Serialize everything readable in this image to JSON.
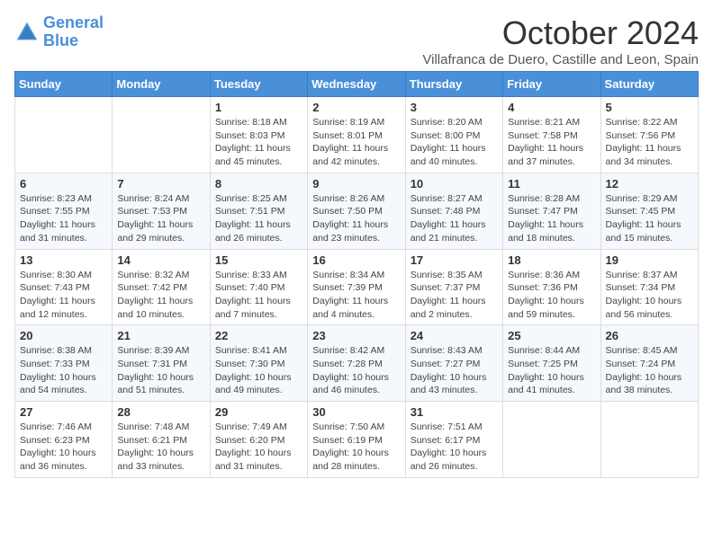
{
  "header": {
    "logo_line1": "General",
    "logo_line2": "Blue",
    "month_year": "October 2024",
    "location": "Villafranca de Duero, Castille and Leon, Spain"
  },
  "weekdays": [
    "Sunday",
    "Monday",
    "Tuesday",
    "Wednesday",
    "Thursday",
    "Friday",
    "Saturday"
  ],
  "weeks": [
    [
      {
        "day": "",
        "info": ""
      },
      {
        "day": "",
        "info": ""
      },
      {
        "day": "1",
        "info": "Sunrise: 8:18 AM\nSunset: 8:03 PM\nDaylight: 11 hours and 45 minutes."
      },
      {
        "day": "2",
        "info": "Sunrise: 8:19 AM\nSunset: 8:01 PM\nDaylight: 11 hours and 42 minutes."
      },
      {
        "day": "3",
        "info": "Sunrise: 8:20 AM\nSunset: 8:00 PM\nDaylight: 11 hours and 40 minutes."
      },
      {
        "day": "4",
        "info": "Sunrise: 8:21 AM\nSunset: 7:58 PM\nDaylight: 11 hours and 37 minutes."
      },
      {
        "day": "5",
        "info": "Sunrise: 8:22 AM\nSunset: 7:56 PM\nDaylight: 11 hours and 34 minutes."
      }
    ],
    [
      {
        "day": "6",
        "info": "Sunrise: 8:23 AM\nSunset: 7:55 PM\nDaylight: 11 hours and 31 minutes."
      },
      {
        "day": "7",
        "info": "Sunrise: 8:24 AM\nSunset: 7:53 PM\nDaylight: 11 hours and 29 minutes."
      },
      {
        "day": "8",
        "info": "Sunrise: 8:25 AM\nSunset: 7:51 PM\nDaylight: 11 hours and 26 minutes."
      },
      {
        "day": "9",
        "info": "Sunrise: 8:26 AM\nSunset: 7:50 PM\nDaylight: 11 hours and 23 minutes."
      },
      {
        "day": "10",
        "info": "Sunrise: 8:27 AM\nSunset: 7:48 PM\nDaylight: 11 hours and 21 minutes."
      },
      {
        "day": "11",
        "info": "Sunrise: 8:28 AM\nSunset: 7:47 PM\nDaylight: 11 hours and 18 minutes."
      },
      {
        "day": "12",
        "info": "Sunrise: 8:29 AM\nSunset: 7:45 PM\nDaylight: 11 hours and 15 minutes."
      }
    ],
    [
      {
        "day": "13",
        "info": "Sunrise: 8:30 AM\nSunset: 7:43 PM\nDaylight: 11 hours and 12 minutes."
      },
      {
        "day": "14",
        "info": "Sunrise: 8:32 AM\nSunset: 7:42 PM\nDaylight: 11 hours and 10 minutes."
      },
      {
        "day": "15",
        "info": "Sunrise: 8:33 AM\nSunset: 7:40 PM\nDaylight: 11 hours and 7 minutes."
      },
      {
        "day": "16",
        "info": "Sunrise: 8:34 AM\nSunset: 7:39 PM\nDaylight: 11 hours and 4 minutes."
      },
      {
        "day": "17",
        "info": "Sunrise: 8:35 AM\nSunset: 7:37 PM\nDaylight: 11 hours and 2 minutes."
      },
      {
        "day": "18",
        "info": "Sunrise: 8:36 AM\nSunset: 7:36 PM\nDaylight: 10 hours and 59 minutes."
      },
      {
        "day": "19",
        "info": "Sunrise: 8:37 AM\nSunset: 7:34 PM\nDaylight: 10 hours and 56 minutes."
      }
    ],
    [
      {
        "day": "20",
        "info": "Sunrise: 8:38 AM\nSunset: 7:33 PM\nDaylight: 10 hours and 54 minutes."
      },
      {
        "day": "21",
        "info": "Sunrise: 8:39 AM\nSunset: 7:31 PM\nDaylight: 10 hours and 51 minutes."
      },
      {
        "day": "22",
        "info": "Sunrise: 8:41 AM\nSunset: 7:30 PM\nDaylight: 10 hours and 49 minutes."
      },
      {
        "day": "23",
        "info": "Sunrise: 8:42 AM\nSunset: 7:28 PM\nDaylight: 10 hours and 46 minutes."
      },
      {
        "day": "24",
        "info": "Sunrise: 8:43 AM\nSunset: 7:27 PM\nDaylight: 10 hours and 43 minutes."
      },
      {
        "day": "25",
        "info": "Sunrise: 8:44 AM\nSunset: 7:25 PM\nDaylight: 10 hours and 41 minutes."
      },
      {
        "day": "26",
        "info": "Sunrise: 8:45 AM\nSunset: 7:24 PM\nDaylight: 10 hours and 38 minutes."
      }
    ],
    [
      {
        "day": "27",
        "info": "Sunrise: 7:46 AM\nSunset: 6:23 PM\nDaylight: 10 hours and 36 minutes."
      },
      {
        "day": "28",
        "info": "Sunrise: 7:48 AM\nSunset: 6:21 PM\nDaylight: 10 hours and 33 minutes."
      },
      {
        "day": "29",
        "info": "Sunrise: 7:49 AM\nSunset: 6:20 PM\nDaylight: 10 hours and 31 minutes."
      },
      {
        "day": "30",
        "info": "Sunrise: 7:50 AM\nSunset: 6:19 PM\nDaylight: 10 hours and 28 minutes."
      },
      {
        "day": "31",
        "info": "Sunrise: 7:51 AM\nSunset: 6:17 PM\nDaylight: 10 hours and 26 minutes."
      },
      {
        "day": "",
        "info": ""
      },
      {
        "day": "",
        "info": ""
      }
    ]
  ]
}
